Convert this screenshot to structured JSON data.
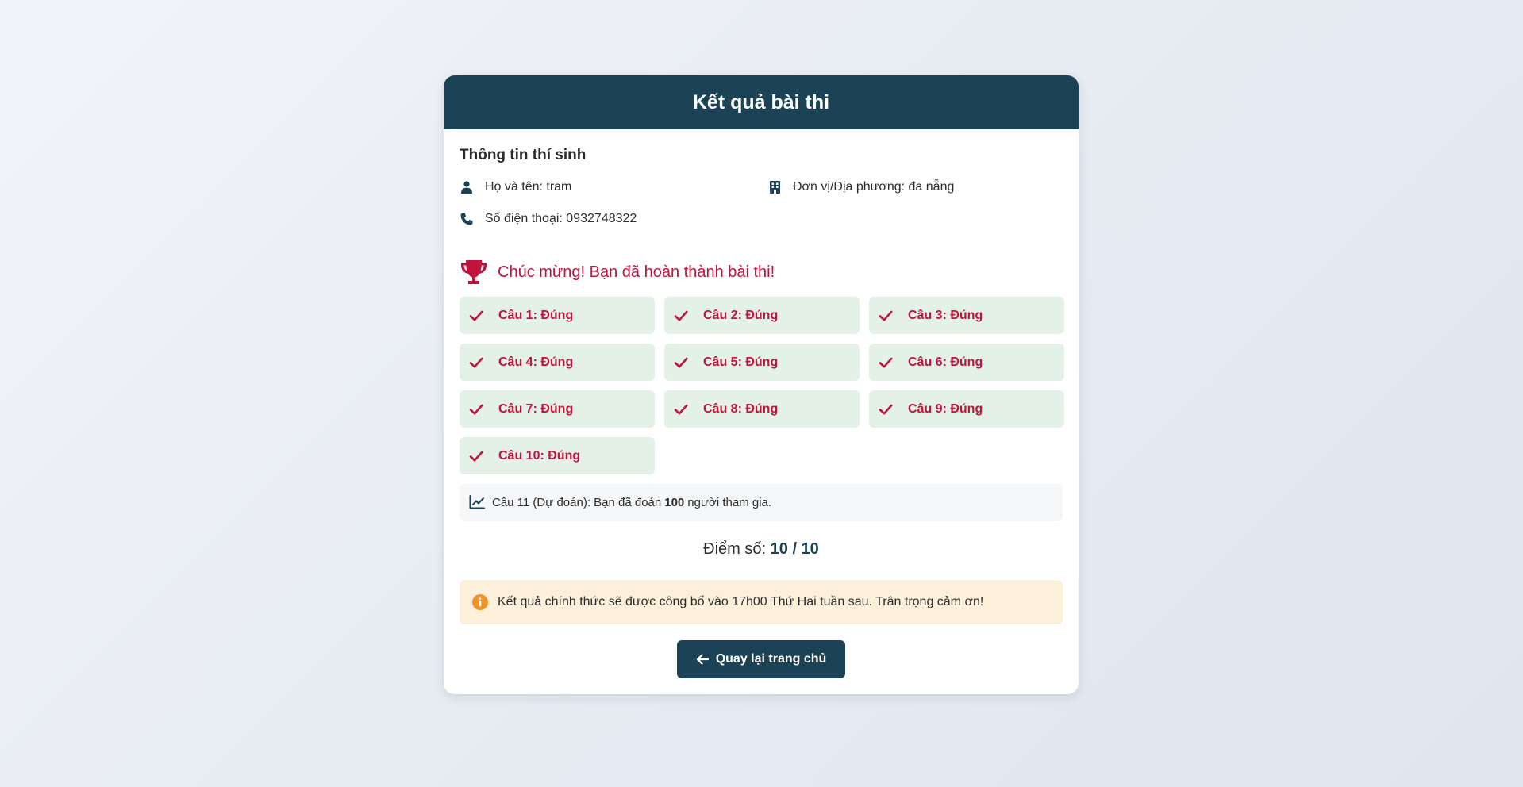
{
  "header": {
    "title": "Kết quả bài thi"
  },
  "candidate": {
    "section_title": "Thông tin thí sinh",
    "name_text": "Họ và tên: tram",
    "unit_text": "Đơn vị/Địa phương: đa nẵng",
    "phone_text": "Số điện thoại: 0932748322",
    "icons": {
      "name": "user-icon",
      "unit": "building-icon",
      "phone": "phone-icon"
    }
  },
  "congrats": {
    "text": "Chúc mừng! Bạn đã hoàn thành bài thi!",
    "icon": "trophy-icon"
  },
  "answers": [
    {
      "label": "Câu 1: Đúng"
    },
    {
      "label": "Câu 2: Đúng"
    },
    {
      "label": "Câu 3: Đúng"
    },
    {
      "label": "Câu 4: Đúng"
    },
    {
      "label": "Câu 5: Đúng"
    },
    {
      "label": "Câu 6: Đúng"
    },
    {
      "label": "Câu 7: Đúng"
    },
    {
      "label": "Câu 8: Đúng"
    },
    {
      "label": "Câu 9: Đúng"
    },
    {
      "label": "Câu 10: Đúng"
    }
  ],
  "prediction": {
    "prefix": "Câu 11 (Dự đoán): Bạn đã đoán",
    "value": "100",
    "suffix": "người tham gia.",
    "icon": "chart-line-icon"
  },
  "score": {
    "label": "Điểm số:",
    "value": "10 / 10"
  },
  "notice": {
    "text": "Kết quả chính thức sẽ được công bố vào 17h00 Thứ Hai tuần sau. Trân trọng cảm ơn!",
    "icon": "info-icon"
  },
  "back_button": {
    "label": "Quay lại trang chủ",
    "icon": "arrow-left-icon"
  },
  "colors": {
    "primary": "#1c4256",
    "accent_red": "#c0143c",
    "correct_bg": "#e3f1e6",
    "notice_bg": "#fdf0da",
    "notice_icon": "#f0932b"
  }
}
